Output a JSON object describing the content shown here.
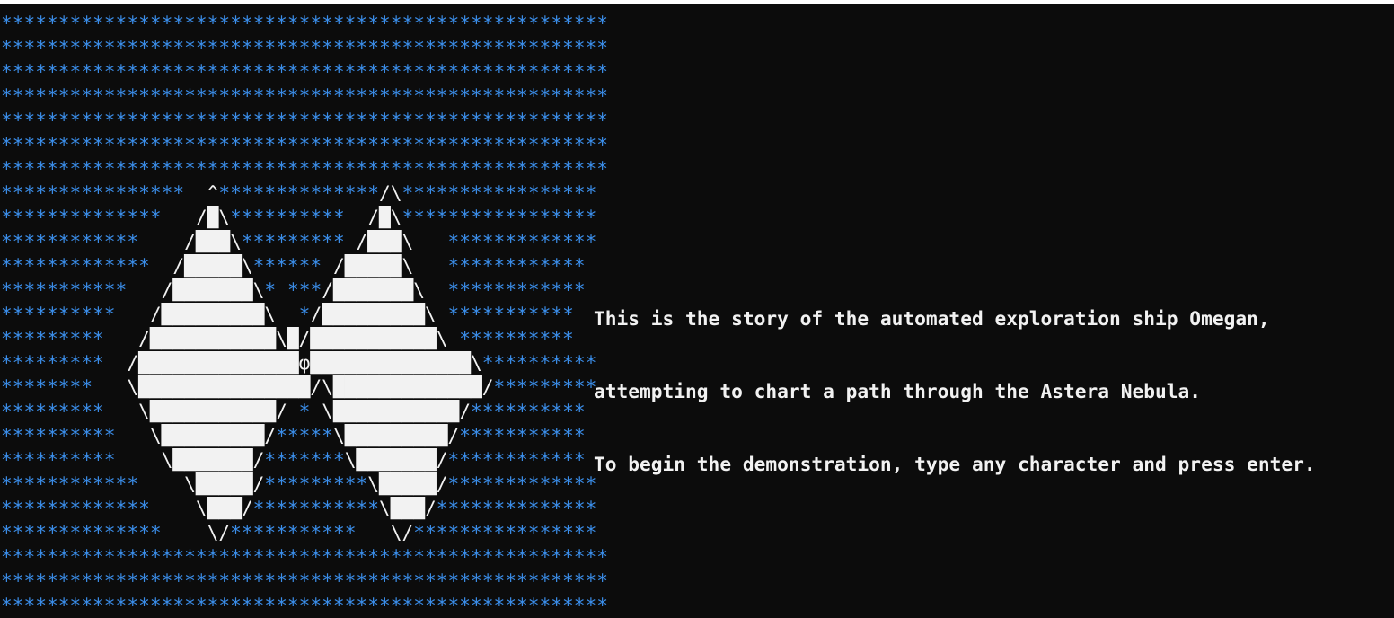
{
  "colors": {
    "background": "#0c0c0c",
    "star": "#3b8eea",
    "text": "#f2f2f2"
  },
  "ascii_art": {
    "rows": [
      "*****************************************************",
      "*****************************************************",
      "*****************************************************",
      "*****************************************************",
      "*****************************************************",
      "*****************************************************",
      "*****************************************************",
      "****************  ^**************/\\*****************",
      "**************   /█\\**********  /█\\*****************",
      "************    /███\\********* /███\\   *************",
      "*************  /█████\\****** /█████\\   ************",
      "***********   /███████\\* ***/███████\\  ************",
      "**********   /█████████\\  */█████████\\ ***********",
      "*********   /███████████\\█/███████████\\ **********",
      "*********  /██████████████φ██████████████\\**********",
      "********   \\███████████████/\\█████████████/*********",
      "*********   \\███████████/ * \\███████████/**********",
      "**********   \\█████████/*****\\█████████/***********",
      "**********    \\███████/*******\\███████/************",
      "************    \\█████/*********\\█████/*************",
      "*************    \\███/***********\\███/**************",
      "**************    \\/***********   \\/****************",
      "*****************************************************",
      "*****************************************************",
      "*****************************************************"
    ]
  },
  "story": {
    "line1": "This is the story of the automated exploration ship Omegan,",
    "line2": "attempting to chart a path through the Astera Nebula.",
    "line3": "To begin the demonstration, type any character and press enter."
  }
}
